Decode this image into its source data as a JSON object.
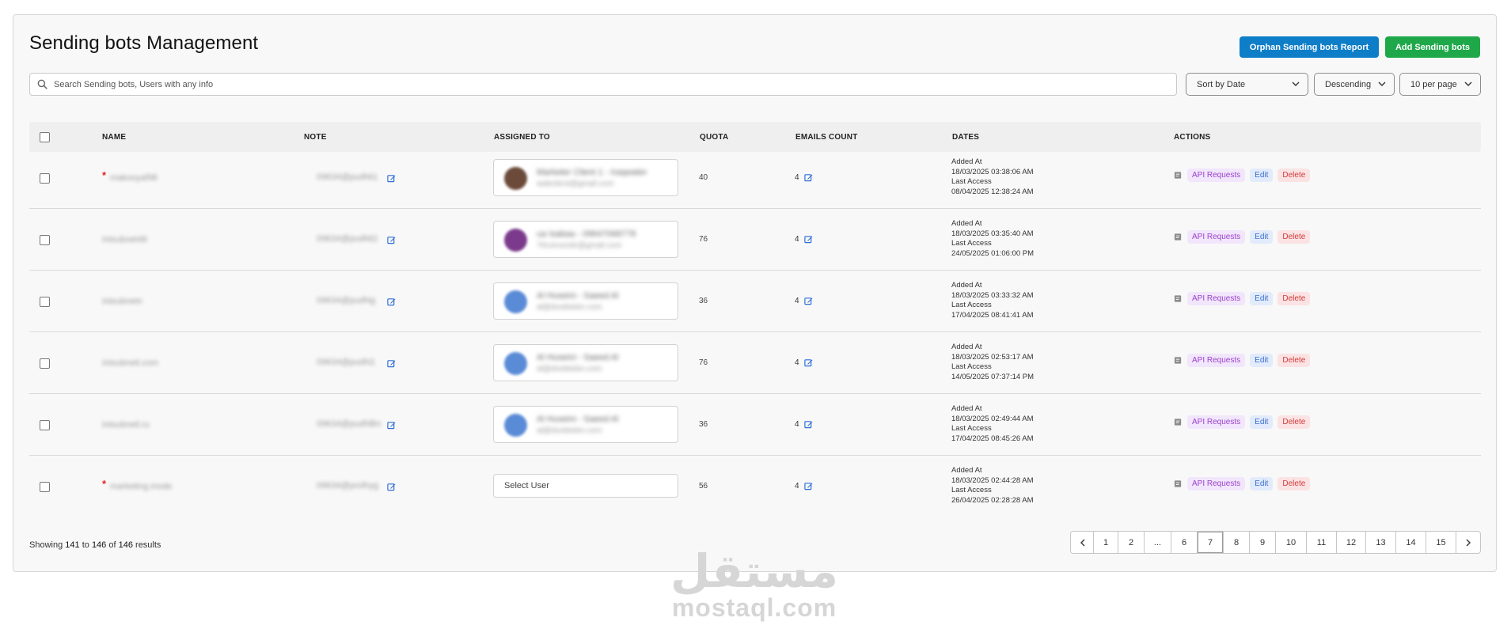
{
  "page": {
    "title": "Sending bots Management",
    "orphan_button": "Orphan Sending bots Report",
    "add_button": "Add Sending bots"
  },
  "search": {
    "placeholder": "Search Sending bots, Users with any info"
  },
  "filters": {
    "sort": "Sort by Date",
    "order": "Descending",
    "per_page": "10 per page"
  },
  "table": {
    "headers": [
      "NAME",
      "NOTE",
      "ASSIGNED TO",
      "QUOTA",
      "EMAILS COUNT",
      "DATES",
      "ACTIONS"
    ],
    "rows": [
      {
        "starred": true,
        "name": "makooyaf98",
        "note": "09634@pudNt1",
        "assigned": {
          "name": "Marketer Client 1 - Iraqwater",
          "email": "wabclient@gmail.com",
          "avatar": "#6b4a3a"
        },
        "quota": "40",
        "emails_count": "4",
        "added_label": "Added At",
        "added": "18/03/2025 03:38:06 AM",
        "access_label": "Last Access",
        "access": "08/04/2025 12:38:24 AM"
      },
      {
        "starred": false,
        "name": "intsubnet48",
        "note": "09634@pudNt2",
        "assigned": {
          "name": "ua Isabaa - 09647068778",
          "email": "76ruinvestir@gmail.com",
          "avatar": "#7c3a8c"
        },
        "quota": "76",
        "emails_count": "4",
        "added_label": "Added At",
        "added": "18/03/2025 03:35:40 AM",
        "access_label": "Last Access",
        "access": "24/05/2025 01:06:00 PM"
      },
      {
        "starred": false,
        "name": "intsubnetn",
        "note": "09634@pudNg",
        "assigned": {
          "name": "Al Huseini - Saeed Al",
          "email": "al@doobiekin.com",
          "avatar": "#5a8bd6"
        },
        "quota": "36",
        "emails_count": "4",
        "added_label": "Added At",
        "added": "18/03/2025 03:33:32 AM",
        "access_label": "Last Access",
        "access": "17/04/2025 08:41:41 AM"
      },
      {
        "starred": false,
        "name": "intsubnetl.com",
        "note": "09634@pudN1",
        "assigned": {
          "name": "Al Huseini - Saeed Al",
          "email": "al@doobiekin.com",
          "avatar": "#5a8bd6"
        },
        "quota": "76",
        "emails_count": "4",
        "added_label": "Added At",
        "added": "18/03/2025 02:53:17 AM",
        "access_label": "Last Access",
        "access": "14/05/2025 07:37:14 PM"
      },
      {
        "starred": false,
        "name": "intsubnetl.ru",
        "note": "09634@pudNBn",
        "assigned": {
          "name": "Al Huseini - Saeed Al",
          "email": "al@doobiekin.com",
          "avatar": "#5a8bd6"
        },
        "quota": "36",
        "emails_count": "4",
        "added_label": "Added At",
        "added": "18/03/2025 02:49:44 AM",
        "access_label": "Last Access",
        "access": "17/04/2025 08:45:26 AM"
      },
      {
        "starred": true,
        "name": "marketing.inode",
        "note": "09634@prolhyg",
        "assigned": null,
        "select_user": "Select User",
        "quota": "56",
        "emails_count": "4",
        "added_label": "Added At",
        "added": "18/03/2025 02:44:28 AM",
        "access_label": "Last Access",
        "access": "26/04/2025 02:28:28 AM"
      }
    ],
    "actions": {
      "api": "API Requests",
      "edit": "Edit",
      "delete": "Delete"
    }
  },
  "footer": {
    "showing_prefix": "Showing",
    "from": "141",
    "to_word": "to",
    "to": "146",
    "of_word": "of",
    "total": "146",
    "results_word": "results"
  },
  "pagination": {
    "pages": [
      "1",
      "2",
      "...",
      "6",
      "7",
      "8",
      "9",
      "10",
      "11",
      "12",
      "13",
      "14",
      "15"
    ],
    "active": "7"
  },
  "watermark": {
    "arabic": "مستقل",
    "latin": "mostaql.com"
  },
  "colors": {
    "orphan": "#0f7ec8",
    "add": "#1fa84a",
    "api": "#9b42cc",
    "edit": "#3b6fd0",
    "delete": "#d33a3a",
    "note_edit_icon": "#2f6fd6"
  }
}
